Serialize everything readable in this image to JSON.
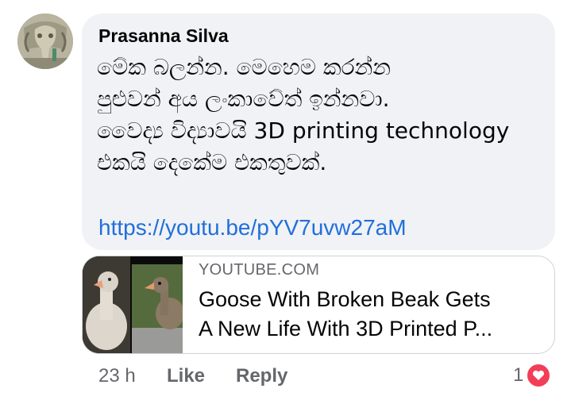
{
  "comment": {
    "author": "Prasanna Silva",
    "message_lines": [
      "මේක බලන්න. මෙහෙම කරන්න",
      "පුළුවන් අය ලංකාවේත් ඉන්නවා.",
      "වෛද්‍ය විද්‍යාවයි 3D printing technology",
      "එකයි දෙකේම එකතුවක්."
    ],
    "link": "https://youtu.be/pYV7uvw27aM"
  },
  "preview": {
    "domain": "YOUTUBE.COM",
    "title_line1": "Goose With Broken Beak Gets",
    "title_line2": "A New Life With 3D Printed P..."
  },
  "actions": {
    "time": "23 h",
    "like": "Like",
    "reply": "Reply"
  },
  "reactions": {
    "count": "1",
    "icon": "heart-icon",
    "color": "#f33e58"
  },
  "colors": {
    "bubble": "#f0f2f5",
    "link": "#216fdb",
    "secondary_text": "#65676b"
  }
}
